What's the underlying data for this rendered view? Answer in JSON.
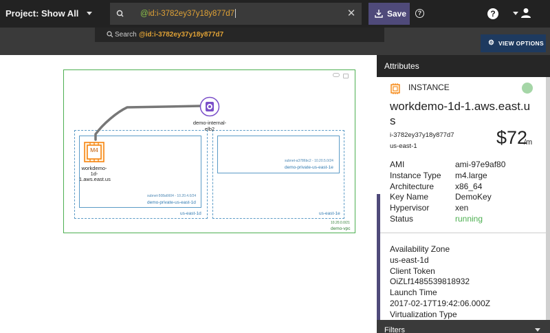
{
  "header": {
    "project_label": "Project: Show All",
    "search_query_prefix": "@",
    "search_query_rest": "id:i-3782ey37y18y877d7",
    "save_label": "Save"
  },
  "suggestion": {
    "label": "Search",
    "value": "@id:i-3782ey37y18y877d7"
  },
  "toolbar": {
    "view_options_label": "VIEW OPTIONS"
  },
  "diagram": {
    "elb_label": "demo-internal-elb2",
    "instance_badge": "M4",
    "instance_label": "workdemo-1d-1.aws.east.us",
    "subnet1_id": "subnet-508a6604 - 10.20.4.0/24",
    "subnet1_name": "demo-private-us-east-1d",
    "subnet2_id": "subnet-a3786bc2 - 10.20.5.0/24",
    "subnet2_name": "demo-private-us-east-1e",
    "az1_label": "us-east-1d",
    "az2_label": "us-east-1e",
    "vpc_cidr": "10.20.0.0/21",
    "vpc_name": "demo-vpc"
  },
  "panel": {
    "title": "Attributes",
    "type_label": "INSTANCE",
    "instance_name": "workdemo-1d-1.aws.east.us",
    "instance_id": "i-3782ey37y18y877d7",
    "region": "us-east-1",
    "price": "$72",
    "price_unit": "/m",
    "attributes": [
      {
        "key": "AMI",
        "value": "ami-97e9af80"
      },
      {
        "key": "Instance Type",
        "value": "m4.large"
      },
      {
        "key": "Architecture",
        "value": "x86_64"
      },
      {
        "key": "Key Name",
        "value": "DemoKey"
      },
      {
        "key": "Hypervisor",
        "value": "xen"
      },
      {
        "key": "Status",
        "value": "running"
      }
    ],
    "extra": [
      "Availability Zone",
      "us-east-1d",
      "Client Token",
      "OiZLf1485539818932",
      "Launch Time",
      "2017-02-17T19:42:06.000Z",
      "Virtualization Type"
    ],
    "filters_label": "Filters"
  },
  "colors": {
    "topbar": "#222222",
    "accent_purple": "#4f4a7a",
    "query_orange": "#e0a236",
    "running_green": "#4caf50",
    "vpc_green": "#4caf50",
    "subnet_blue": "#5a9ac6"
  },
  "icons": [
    "caret-down-icon",
    "search-icon",
    "close-icon",
    "download-icon",
    "help-icon",
    "user-icon",
    "gear-icon",
    "cloud-icon",
    "lock-icon",
    "load-balancer-icon",
    "ec2-instance-icon",
    "chip-icon"
  ]
}
